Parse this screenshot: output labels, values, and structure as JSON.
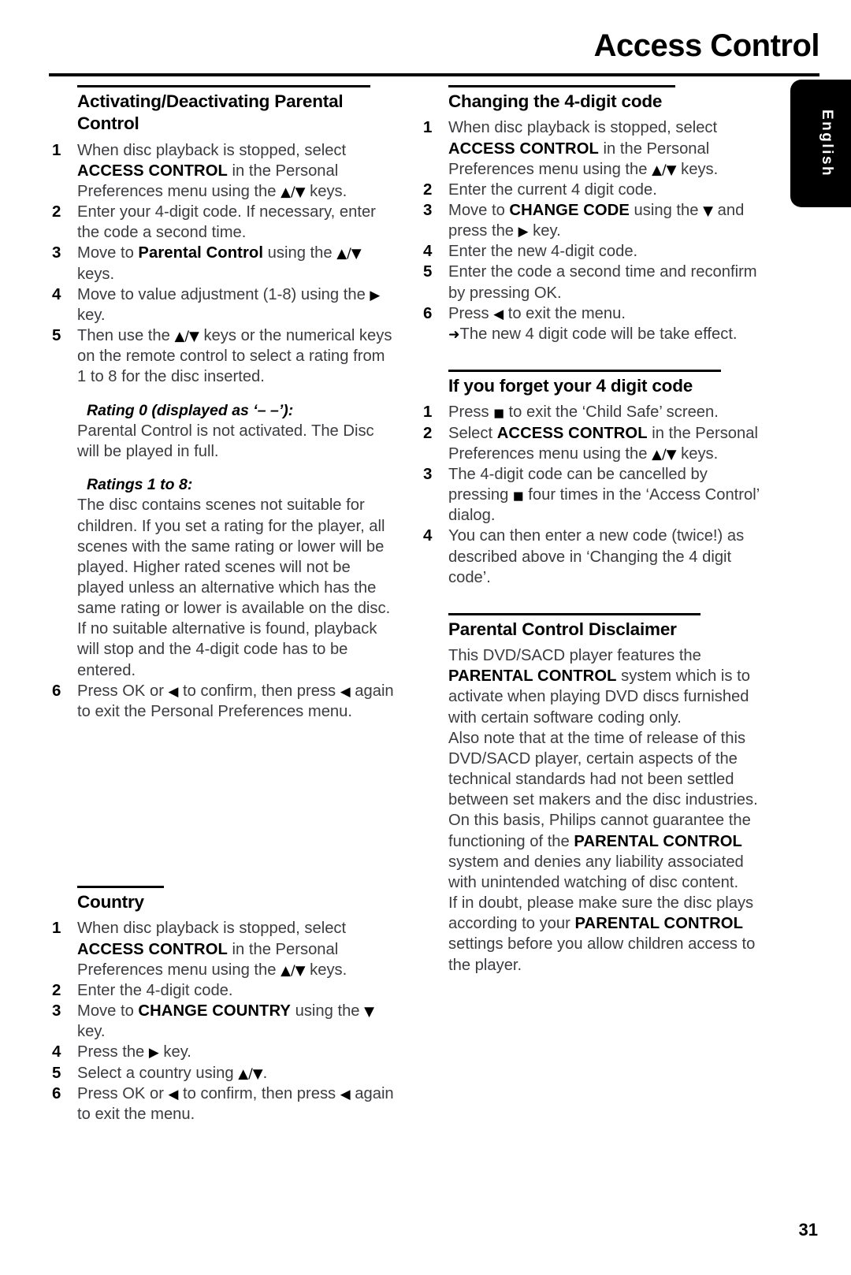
{
  "document": {
    "title": "Access Control",
    "page_number": "31",
    "language_tab": "English"
  },
  "left_column": {
    "section_parental": {
      "heading": "Activating/Deactivating Parental Control",
      "steps": [
        {
          "num": "1",
          "parts": [
            {
              "t": "text",
              "v": "When disc playback is stopped, select "
            },
            {
              "t": "bold",
              "v": "ACCESS CONTROL"
            },
            {
              "t": "text",
              "v": " in the Personal Preferences menu using the "
            },
            {
              "t": "glyph",
              "v": "▲/▼"
            },
            {
              "t": "text",
              "v": " keys."
            }
          ]
        },
        {
          "num": "2",
          "parts": [
            {
              "t": "text",
              "v": "Enter your 4-digit code. If necessary, enter the code a second time."
            }
          ]
        },
        {
          "num": "3",
          "parts": [
            {
              "t": "text",
              "v": "Move to "
            },
            {
              "t": "bold",
              "v": "Parental Control"
            },
            {
              "t": "text",
              "v": " using the "
            },
            {
              "t": "glyph",
              "v": "▲/▼"
            },
            {
              "t": "text",
              "v": " keys."
            }
          ]
        },
        {
          "num": "4",
          "parts": [
            {
              "t": "text",
              "v": "Move to value adjustment (1-8) using the "
            },
            {
              "t": "glyph",
              "v": "▶"
            },
            {
              "t": "text",
              "v": " key."
            }
          ]
        },
        {
          "num": "5",
          "parts": [
            {
              "t": "text",
              "v": "Then use the "
            },
            {
              "t": "glyph",
              "v": "▲/▼"
            },
            {
              "t": "text",
              "v": " keys or the numerical keys on the remote control to select a rating from 1 to 8 for the disc inserted."
            }
          ]
        }
      ],
      "rating0_head": "Rating 0 (displayed as ‘– –’):",
      "rating0_body": "Parental Control is not activated. The Disc will be played in full.",
      "ratings18_head": "Ratings 1 to 8:",
      "ratings18_body": "The disc contains scenes not suitable for children. If you set a rating for the player, all scenes with the same rating or lower will be played. Higher rated scenes will not be played unless an alternative which has the same rating or lower is available on the disc. If no suitable alternative is found, playback will stop and the 4-digit code has to be entered.",
      "final_step": {
        "num": "6",
        "parts": [
          {
            "t": "text",
            "v": "Press OK or "
          },
          {
            "t": "glyph",
            "v": "◀"
          },
          {
            "t": "text",
            "v": " to confirm, then press "
          },
          {
            "t": "glyph",
            "v": "◀"
          },
          {
            "t": "text",
            "v": " again to exit the Personal Preferences menu."
          }
        ]
      }
    },
    "section_country": {
      "heading": "Country",
      "steps": [
        {
          "num": "1",
          "parts": [
            {
              "t": "text",
              "v": "When disc playback is stopped, select "
            },
            {
              "t": "bold",
              "v": "ACCESS CONTROL"
            },
            {
              "t": "text",
              "v": " in the Personal Preferences menu using the "
            },
            {
              "t": "glyph",
              "v": "▲/▼"
            },
            {
              "t": "text",
              "v": " keys."
            }
          ]
        },
        {
          "num": "2",
          "parts": [
            {
              "t": "text",
              "v": "Enter the 4-digit code."
            }
          ]
        },
        {
          "num": "3",
          "parts": [
            {
              "t": "text",
              "v": "Move to "
            },
            {
              "t": "bold",
              "v": "CHANGE COUNTRY"
            },
            {
              "t": "text",
              "v": " using the "
            },
            {
              "t": "glyph",
              "v": "▼"
            },
            {
              "t": "text",
              "v": " key."
            }
          ]
        },
        {
          "num": "4",
          "parts": [
            {
              "t": "text",
              "v": "Press the "
            },
            {
              "t": "glyph",
              "v": "▶"
            },
            {
              "t": "text",
              "v": " key."
            }
          ]
        },
        {
          "num": "5",
          "parts": [
            {
              "t": "text",
              "v": "Select a country using "
            },
            {
              "t": "glyph",
              "v": "▲/▼"
            },
            {
              "t": "text",
              "v": "."
            }
          ]
        },
        {
          "num": "6",
          "parts": [
            {
              "t": "text",
              "v": "Press OK or "
            },
            {
              "t": "glyph",
              "v": "◀"
            },
            {
              "t": "text",
              "v": " to confirm, then press "
            },
            {
              "t": "glyph",
              "v": "◀"
            },
            {
              "t": "text",
              "v": " again to exit the menu."
            }
          ]
        }
      ]
    }
  },
  "right_column": {
    "section_change_code": {
      "heading": "Changing the 4-digit code",
      "steps": [
        {
          "num": "1",
          "parts": [
            {
              "t": "text",
              "v": "When disc playback is stopped, select "
            },
            {
              "t": "bold",
              "v": "ACCESS CONTROL"
            },
            {
              "t": "text",
              "v": " in the Personal Preferences menu using the "
            },
            {
              "t": "glyph",
              "v": "▲/▼"
            },
            {
              "t": "text",
              "v": " keys."
            }
          ]
        },
        {
          "num": "2",
          "parts": [
            {
              "t": "text",
              "v": "Enter the current 4 digit code."
            }
          ]
        },
        {
          "num": "3",
          "parts": [
            {
              "t": "text",
              "v": "Move to "
            },
            {
              "t": "bold",
              "v": "CHANGE CODE"
            },
            {
              "t": "text",
              "v": " using the "
            },
            {
              "t": "glyph",
              "v": "▼"
            },
            {
              "t": "text",
              "v": " and press the "
            },
            {
              "t": "glyph",
              "v": "▶"
            },
            {
              "t": "text",
              "v": " key."
            }
          ]
        },
        {
          "num": "4",
          "parts": [
            {
              "t": "text",
              "v": "Enter the new 4-digit code."
            }
          ]
        },
        {
          "num": "5",
          "parts": [
            {
              "t": "text",
              "v": "Enter the code a second time and reconfirm by pressing OK."
            }
          ]
        },
        {
          "num": "6",
          "parts": [
            {
              "t": "text",
              "v": "Press "
            },
            {
              "t": "glyph",
              "v": "◀"
            },
            {
              "t": "text",
              "v": " to exit the menu."
            }
          ]
        }
      ],
      "note": "The new 4 digit code will be take effect.",
      "note_marker": "➜"
    },
    "section_forgot": {
      "heading": "If you forget your 4 digit code",
      "steps": [
        {
          "num": "1",
          "parts": [
            {
              "t": "text",
              "v": "Press "
            },
            {
              "t": "square",
              "v": "■"
            },
            {
              "t": "text",
              "v": " to exit the ‘Child Safe’ screen."
            }
          ]
        },
        {
          "num": "2",
          "parts": [
            {
              "t": "text",
              "v": "Select "
            },
            {
              "t": "bold",
              "v": "ACCESS CONTROL"
            },
            {
              "t": "text",
              "v": " in the Personal Preferences menu  using the "
            },
            {
              "t": "glyph",
              "v": "▲/▼"
            },
            {
              "t": "text",
              "v": " keys."
            }
          ]
        },
        {
          "num": "3",
          "parts": [
            {
              "t": "text",
              "v": "The 4-digit code can be cancelled by pressing "
            },
            {
              "t": "square",
              "v": "■"
            },
            {
              "t": "text",
              "v": " four times in the ‘Access Control’ dialog."
            }
          ]
        },
        {
          "num": "4",
          "parts": [
            {
              "t": "text",
              "v": "You can then enter a new code (twice!) as described above in ‘Changing the 4 digit code’."
            }
          ]
        }
      ]
    },
    "section_disclaimer": {
      "heading": "Parental Control Disclaimer",
      "paragraphs": [
        [
          {
            "t": "text",
            "v": "This DVD/SACD player features the "
          },
          {
            "t": "bold",
            "v": "PARENTAL CONTROL"
          },
          {
            "t": "text",
            "v": " system which is to activate when playing DVD discs furnished with certain software coding only."
          }
        ],
        [
          {
            "t": "text",
            "v": "Also note that at the time of release of this DVD/SACD player, certain aspects of the technical standards had not been settled between set makers and the disc industries. On this basis, Philips cannot guarantee the functioning of the "
          },
          {
            "t": "bold",
            "v": "PARENTAL CONTROL"
          },
          {
            "t": "text",
            "v": " system and denies any liability associated with unintended watching of disc content."
          }
        ],
        [
          {
            "t": "text",
            "v": "If in doubt, please make sure the disc plays according to your "
          },
          {
            "t": "bold",
            "v": "PARENTAL CONTROL"
          },
          {
            "t": "text",
            "v": " settings before you allow children access to the player."
          }
        ]
      ]
    }
  }
}
